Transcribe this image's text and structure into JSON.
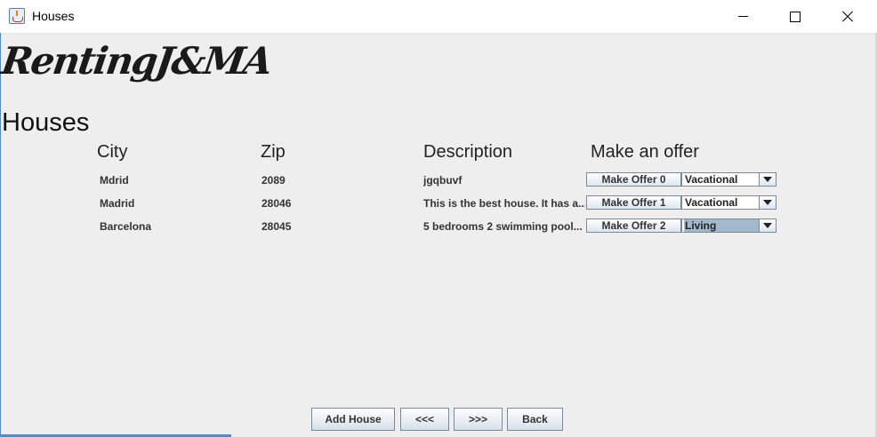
{
  "window": {
    "title": "Houses",
    "icon": "java-cup-icon",
    "controls": [
      "minimize-icon",
      "maximize-icon",
      "close-icon"
    ]
  },
  "logo": {
    "text": "RentingJ&MA"
  },
  "page": {
    "title": "Houses",
    "columns": {
      "city": "City",
      "zip": "Zip",
      "description": "Description",
      "offer": "Make an offer"
    }
  },
  "rows": [
    {
      "city": "Mdrid",
      "zip": "2089",
      "description": "jgqbuvf",
      "offer_label": "Make Offer 0",
      "type": "Vacational"
    },
    {
      "city": "Madrid",
      "zip": "28046",
      "description": "This is the best house. It has a...",
      "offer_label": "Make Offer 1",
      "type": "Vacational"
    },
    {
      "city": "Barcelona",
      "zip": "28045",
      "description": "5 bedrooms 2 swimming pool...",
      "offer_label": "Make Offer 2",
      "type": "Living"
    }
  ],
  "buttons": {
    "add_house": "Add House",
    "prev": "<<<",
    "next": ">>>",
    "back": "Back"
  },
  "colors": {
    "background": "#eeeeee",
    "selection": "#a3b8cc",
    "frame": "#5b8ac0"
  }
}
